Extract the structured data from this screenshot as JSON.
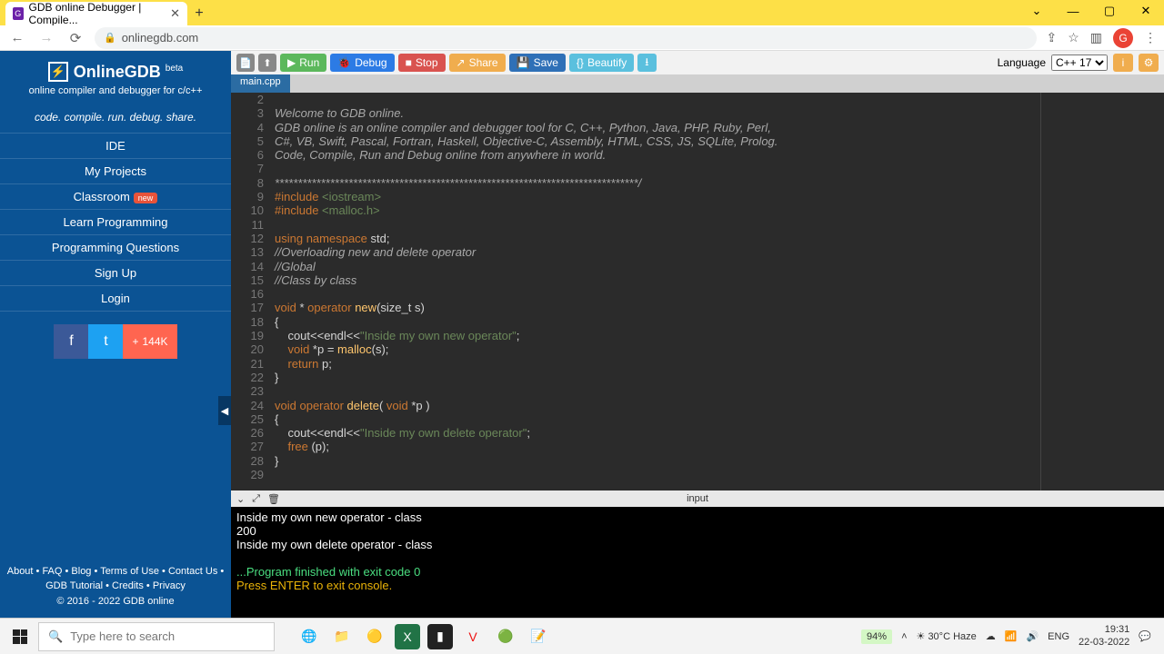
{
  "browser": {
    "tab_title": "GDB online Debugger | Compile...",
    "url": "onlinegdb.com",
    "avatar_letter": "G"
  },
  "win_controls": {
    "min": "—",
    "max": "▢",
    "close": "✕",
    "down": "⌄"
  },
  "sidebar": {
    "title": "OnlineGDB",
    "beta": "beta",
    "subtitle": "online compiler and debugger for c/c++",
    "tagline": "code. compile. run. debug. share.",
    "items": [
      "IDE",
      "My Projects",
      "Classroom",
      "Learn Programming",
      "Programming Questions",
      "Sign Up",
      "Login"
    ],
    "classroom_badge": "new",
    "share_count": "144K",
    "footer_links": "About • FAQ • Blog • Terms of Use • Contact Us • GDB Tutorial • Credits • Privacy",
    "copyright": "© 2016 - 2022 GDB online"
  },
  "toolbar": {
    "run": "Run",
    "debug": "Debug",
    "stop": "Stop",
    "share": "Share",
    "save": "Save",
    "beautify": "Beautify",
    "language_label": "Language",
    "language_value": "C++ 17"
  },
  "file_tab": "main.cpp",
  "code_lines": [
    {
      "n": 2,
      "html": ""
    },
    {
      "n": 3,
      "html": "<span class='c-com c-ital'>Welcome to GDB online.</span>"
    },
    {
      "n": 4,
      "html": "<span class='c-com c-ital'>GDB online is an online compiler and debugger tool for C, C++, Python, Java, PHP, Ruby, Perl,</span>"
    },
    {
      "n": 5,
      "html": "<span class='c-com c-ital'>C#, VB, Swift, Pascal, Fortran, Haskell, Objective-C, Assembly, HTML, CSS, JS, SQLite, Prolog.</span>"
    },
    {
      "n": 6,
      "html": "<span class='c-com c-ital'>Code, Compile, Run and Debug online from anywhere in world.</span>"
    },
    {
      "n": 7,
      "html": ""
    },
    {
      "n": 8,
      "html": "<span class='c-com c-ital'>*******************************************************************************/</span>"
    },
    {
      "n": 9,
      "html": "<span class='c-prep'>#include </span><span class='c-inc'>&lt;iostream&gt;</span>"
    },
    {
      "n": 10,
      "html": "<span class='c-prep'>#include </span><span class='c-inc'>&lt;malloc.h&gt;</span>"
    },
    {
      "n": 11,
      "html": ""
    },
    {
      "n": 12,
      "html": "<span class='c-kw'>using namespace</span> std;"
    },
    {
      "n": 13,
      "html": "<span class='c-com c-ital'>//Overloading new and delete operator</span>"
    },
    {
      "n": 14,
      "html": "<span class='c-com c-ital'>//Global</span>"
    },
    {
      "n": 15,
      "html": "<span class='c-com c-ital'>//Class by class</span>"
    },
    {
      "n": 16,
      "html": ""
    },
    {
      "n": 17,
      "html": "<span class='c-kw'>void</span> * <span class='c-kw'>operator</span> <span class='c-fn'>new</span>(size_t s)"
    },
    {
      "n": 18,
      "html": "{"
    },
    {
      "n": 19,
      "html": "    cout&lt;&lt;endl&lt;&lt;<span class='c-str'>\"Inside my own new operator\"</span>;"
    },
    {
      "n": 20,
      "html": "    <span class='c-kw'>void</span> *p = <span class='c-fn'>malloc</span>(s);"
    },
    {
      "n": 21,
      "html": "    <span class='c-kw'>return</span> p;"
    },
    {
      "n": 22,
      "html": "}"
    },
    {
      "n": 23,
      "html": ""
    },
    {
      "n": 24,
      "html": "<span class='c-kw'>void</span> <span class='c-kw'>operator</span> <span class='c-fn'>delete</span>( <span class='c-kw'>void</span> *p )"
    },
    {
      "n": 25,
      "html": "{"
    },
    {
      "n": 26,
      "html": "    cout&lt;&lt;endl&lt;&lt;<span class='c-str'>\"Inside my own delete operator\"</span>;"
    },
    {
      "n": 27,
      "html": "    <span class='c-kw'>free</span> (p);"
    },
    {
      "n": 28,
      "html": "}"
    },
    {
      "n": 29,
      "html": ""
    }
  ],
  "console_label": "input",
  "console_lines": [
    {
      "cls": "",
      "t": "Inside my own new operator - class"
    },
    {
      "cls": "",
      "t": "200"
    },
    {
      "cls": "",
      "t": "Inside my own delete operator - class"
    },
    {
      "cls": "",
      "t": ""
    },
    {
      "cls": "c-green",
      "t": "...Program finished with exit code 0"
    },
    {
      "cls": "c-yel",
      "t": "Press ENTER to exit console."
    }
  ],
  "taskbar": {
    "search_placeholder": "Type here to search",
    "battery": "94%",
    "weather": "30°C Haze",
    "lang": "ENG",
    "time": "19:31",
    "date": "22-03-2022"
  }
}
